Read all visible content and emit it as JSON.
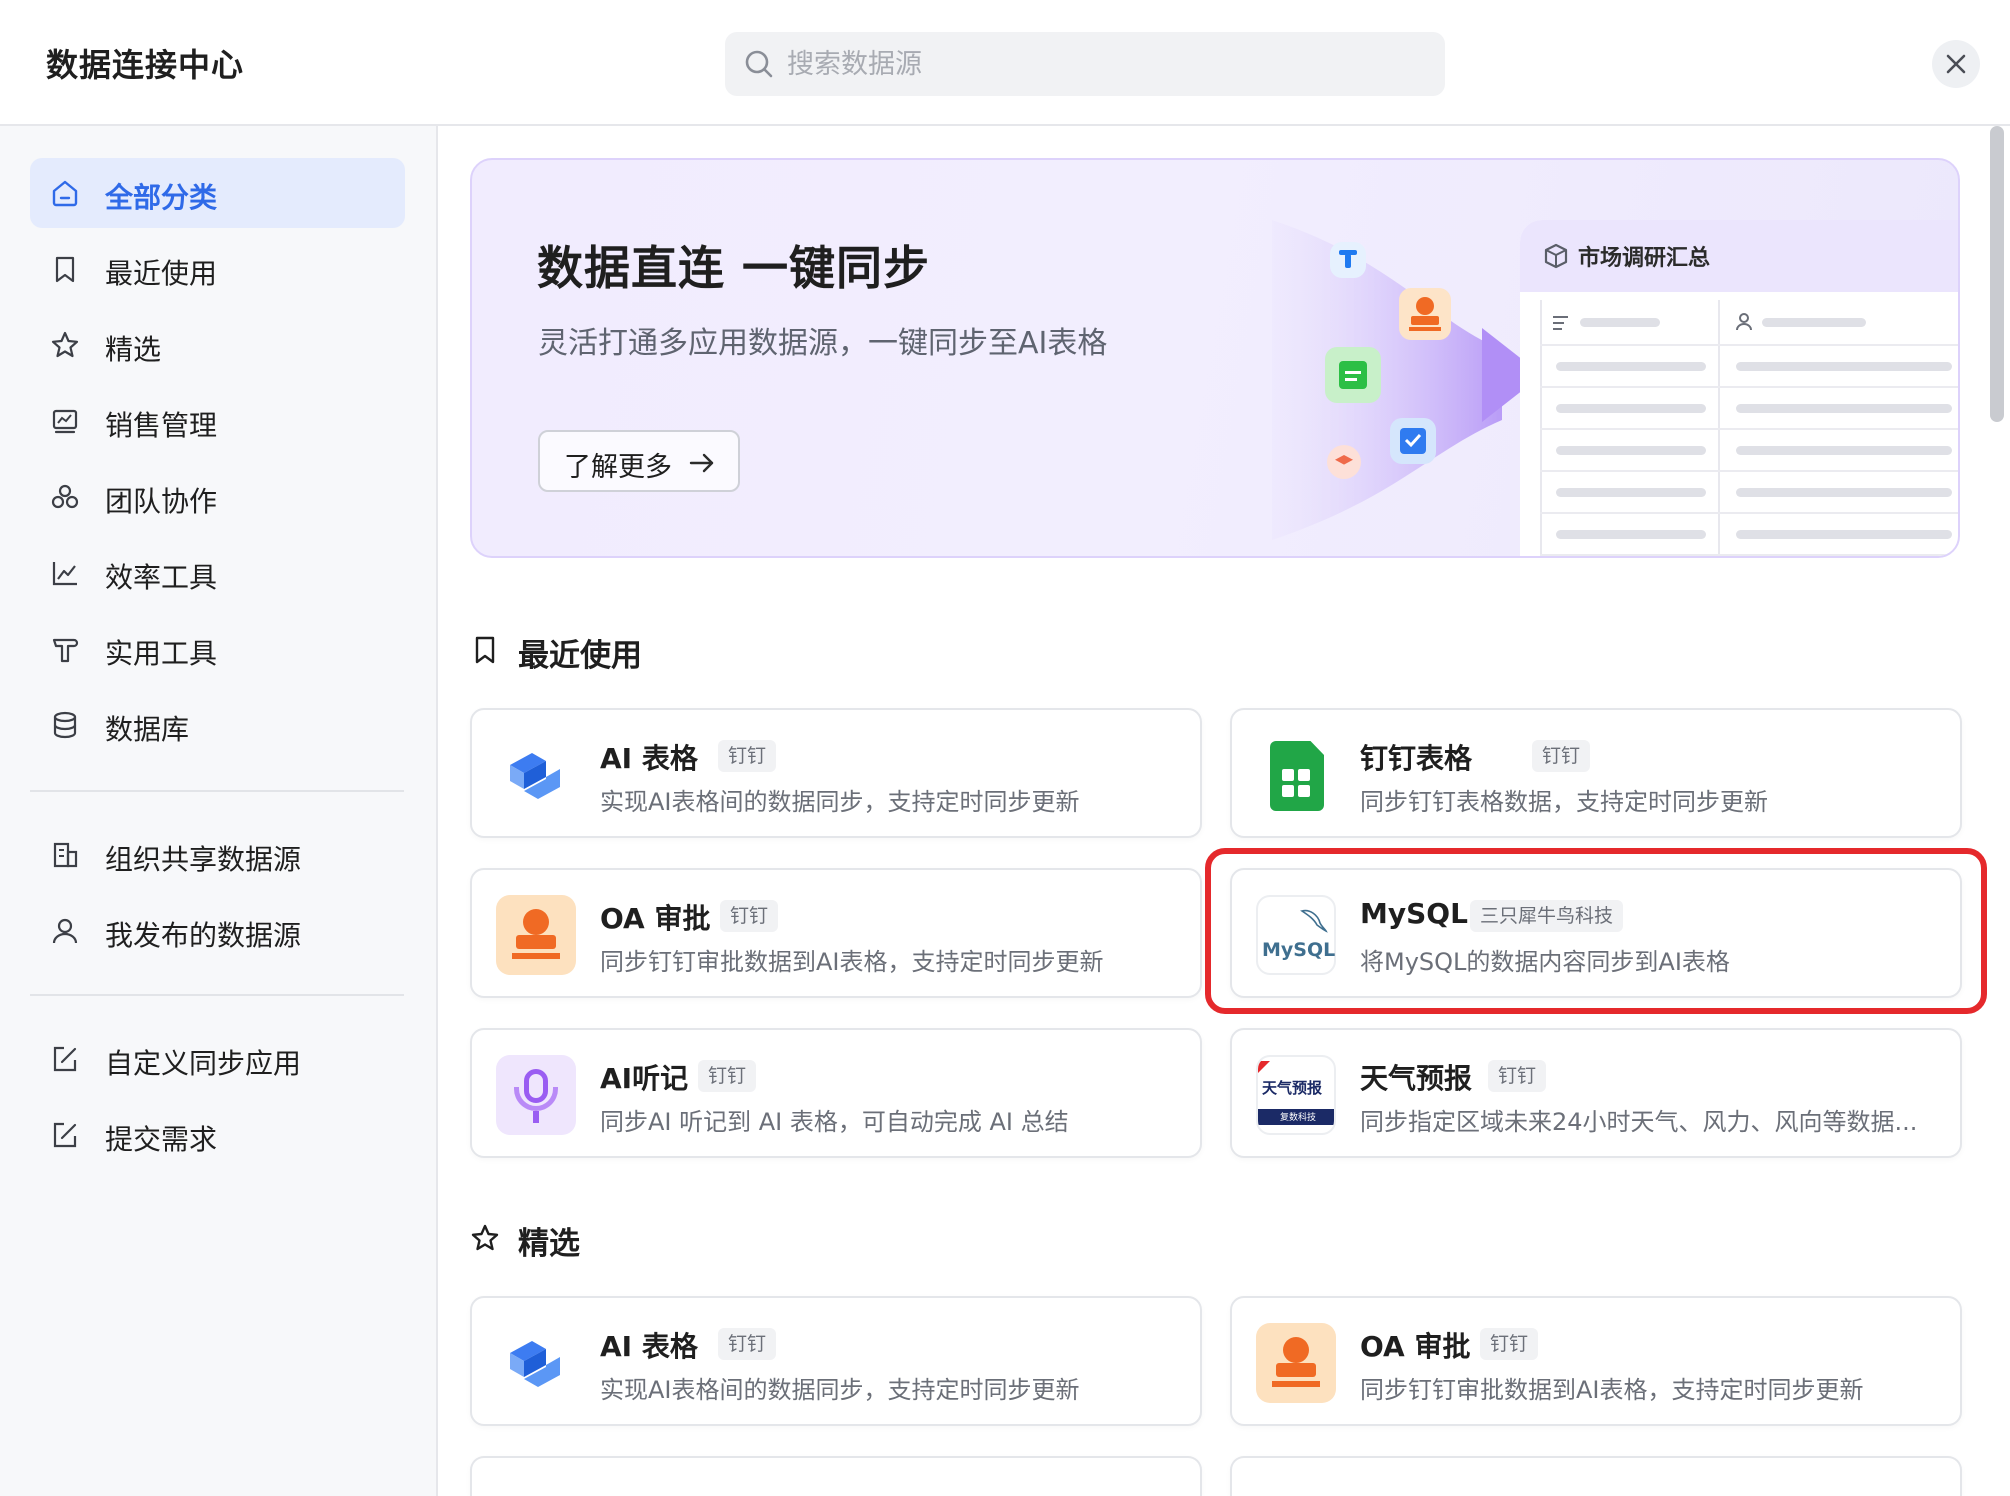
{
  "header": {
    "title": "数据连接中心",
    "search_placeholder": "搜索数据源"
  },
  "sidebar": {
    "items": [
      {
        "label": "全部分类",
        "icon": "home-icon",
        "active": true
      },
      {
        "label": "最近使用",
        "icon": "bookmark-icon"
      },
      {
        "label": "精选",
        "icon": "star-icon"
      },
      {
        "label": "销售管理",
        "icon": "chart-board-icon"
      },
      {
        "label": "团队协作",
        "icon": "team-icon"
      },
      {
        "label": "效率工具",
        "icon": "trend-icon"
      },
      {
        "label": "实用工具",
        "icon": "tool-icon"
      },
      {
        "label": "数据库",
        "icon": "database-icon"
      }
    ],
    "org_items": [
      {
        "label": "组织共享数据源",
        "icon": "building-icon"
      },
      {
        "label": "我发布的数据源",
        "icon": "user-icon"
      }
    ],
    "extra_items": [
      {
        "label": "自定义同步应用",
        "icon": "edit-icon"
      },
      {
        "label": "提交需求",
        "icon": "edit-icon"
      }
    ]
  },
  "banner": {
    "title": "数据直连 一键同步",
    "subtitle": "灵活打通多应用数据源，一键同步至AI表格",
    "button": "了解更多",
    "preview_title": "市场调研汇总"
  },
  "sections": {
    "recent": {
      "title": "最近使用",
      "cards": [
        {
          "name": "AI 表格",
          "tag": "钉钉",
          "desc": "实现AI表格间的数据同步，支持定时同步更新",
          "logo": "ai-table-logo"
        },
        {
          "name": "钉钉表格",
          "tag": "钉钉",
          "desc": "同步钉钉表格数据，支持定时同步更新",
          "logo": "dingtalk-sheet-logo"
        },
        {
          "name": "OA 审批",
          "tag": "钉钉",
          "desc": "同步钉钉审批数据到AI表格，支持定时同步更新",
          "logo": "oa-approval-logo"
        },
        {
          "name": "MySQL",
          "tag": "三只犀牛鸟科技",
          "desc": "将MySQL的数据内容同步到AI表格",
          "logo": "mysql-logo"
        },
        {
          "name": "AI听记",
          "tag": "钉钉",
          "desc": "同步AI 听记到 AI 表格，可自动完成 AI 总结",
          "logo": "ai-minutes-logo"
        },
        {
          "name": "天气预报",
          "tag": "钉钉",
          "desc": "同步指定区域未来24小时天气、风力、风向等数据...",
          "logo": "weather-logo"
        }
      ]
    },
    "featured": {
      "title": "精选",
      "cards": [
        {
          "name": "AI 表格",
          "tag": "钉钉",
          "desc": "实现AI表格间的数据同步，支持定时同步更新",
          "logo": "ai-table-logo"
        },
        {
          "name": "OA 审批",
          "tag": "钉钉",
          "desc": "同步钉钉审批数据到AI表格，支持定时同步更新",
          "logo": "oa-approval-logo"
        }
      ]
    }
  },
  "logo_text": {
    "mysql": "MySQL",
    "weather_top": "天气预报",
    "weather_bottom": "复数科技"
  },
  "colors": {
    "accent": "#2f6ae8",
    "highlight": "#e5292c",
    "active_bg": "#e4ebfd"
  }
}
